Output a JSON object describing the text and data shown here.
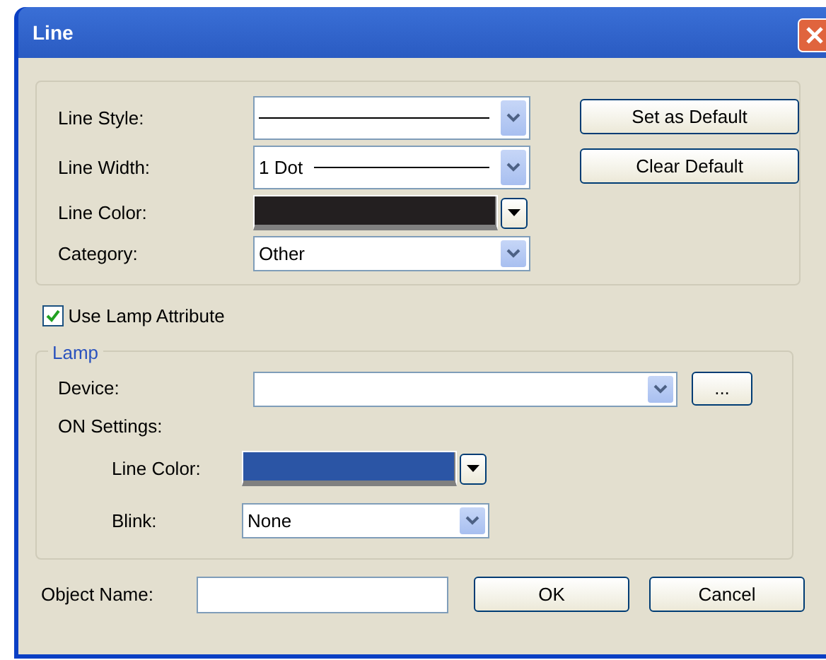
{
  "window": {
    "title": "Line"
  },
  "fields": [
    {
      "kind": "line-combo",
      "label": "Line Style:"
    },
    {
      "kind": "line-combo",
      "label": "Line Width:",
      "value": "1 Dot"
    },
    {
      "kind": "color",
      "label": "Line Color:",
      "color": "#231f20"
    },
    {
      "kind": "combo",
      "label": "Category:",
      "value": "Other"
    }
  ],
  "side_buttons": [
    "Set as Default",
    "Clear Default"
  ],
  "use_lamp": {
    "label": "Use Lamp Attribute",
    "checked": true
  },
  "lamp": {
    "legend": "Lamp",
    "device": {
      "label": "Device:",
      "button": "..."
    },
    "on_settings": "ON Settings:",
    "rows": [
      {
        "kind": "color",
        "label": "Line Color:",
        "color": "#2b55a5"
      },
      {
        "kind": "combo",
        "label": "Blink:",
        "value": "None"
      }
    ]
  },
  "object_name": {
    "label": "Object Name:"
  },
  "footer_buttons": [
    "OK",
    "Cancel"
  ]
}
